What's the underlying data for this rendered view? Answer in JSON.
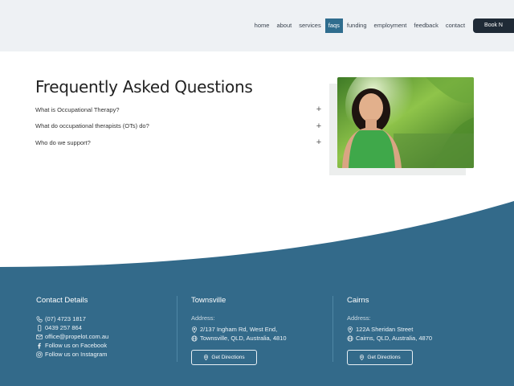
{
  "nav": {
    "items": [
      {
        "label": "home",
        "active": false
      },
      {
        "label": "about",
        "active": false
      },
      {
        "label": "services",
        "active": false
      },
      {
        "label": "faqs",
        "active": true
      },
      {
        "label": "funding",
        "active": false
      },
      {
        "label": "employment",
        "active": false
      },
      {
        "label": "feedback",
        "active": false
      },
      {
        "label": "contact",
        "active": false
      }
    ],
    "book_label": "Book N"
  },
  "faq": {
    "title": "Frequently Asked Questions",
    "questions": [
      {
        "q": "What is Occupational Therapy?",
        "icon": "plus-icon"
      },
      {
        "q": "What do occupational therapists (OTs) do?",
        "icon": "plus-icon"
      },
      {
        "q": "Who do we support?",
        "icon": "plus-icon"
      }
    ],
    "photo": "therapist-portrait"
  },
  "footer": {
    "colors": {
      "background": "#336a8a",
      "accent": "#2f6d8e"
    },
    "contact": {
      "title": "Contact Details",
      "phone": "(07) 4723 1817",
      "mobile": "0439 257 864",
      "email": "office@propelot.com.au",
      "facebook": "Follow us on Facebook",
      "instagram": "Follow us on Instagram"
    },
    "townsville": {
      "title": "Townsville",
      "address_label": "Address:",
      "street": "2/137 Ingham Rd, West End,",
      "city": "Townsville, QLD, Australia, 4810",
      "button": "Get Directions"
    },
    "cairns": {
      "title": "Cairns",
      "address_label": "Address:",
      "street": "122A Sheridan Street",
      "city": "Cairns, QLD, Australia, 4870",
      "button": "Get Directions"
    }
  }
}
